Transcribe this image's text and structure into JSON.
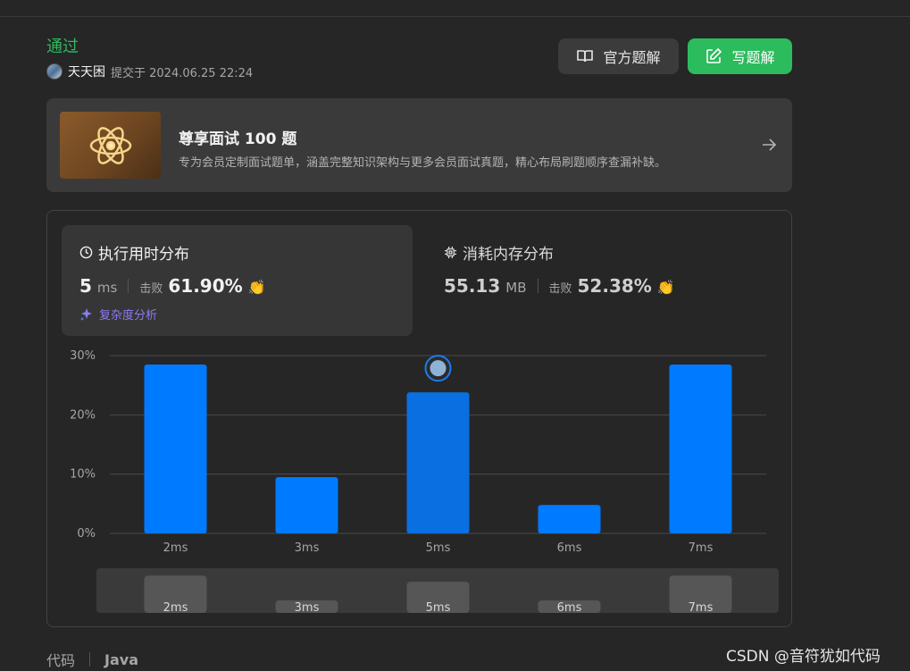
{
  "result": {
    "status": "通过",
    "user": "天天困",
    "submitted_label": "提交于 2024.06.25 22:24"
  },
  "buttons": {
    "official_solution": "官方题解",
    "write_solution": "写题解"
  },
  "promo": {
    "title": "尊享面试 100 题",
    "description": "专为会员定制面试题单，涵盖完整知识架构与更多会员面试真题，精心布局刷题顺序查漏补缺。"
  },
  "runtime": {
    "heading": "执行用时分布",
    "value": "5",
    "unit": "ms",
    "beat_label": "击败",
    "beat_percent": "61.90%",
    "complexity_link": "复杂度分析"
  },
  "memory": {
    "heading": "消耗内存分布",
    "value": "55.13",
    "unit": "MB",
    "beat_label": "击败",
    "beat_percent": "52.38%"
  },
  "chart_data": {
    "type": "bar",
    "categories": [
      "2ms",
      "3ms",
      "5ms",
      "6ms",
      "7ms"
    ],
    "values": [
      28.5,
      9.5,
      23.8,
      4.8,
      28.5
    ],
    "highlight": "5ms",
    "y_ticks": [
      "0%",
      "10%",
      "20%",
      "30%"
    ],
    "ylim": [
      0,
      30
    ],
    "grid": true,
    "colors": {
      "bar": "#007aff",
      "highlight": "#0a6fe0",
      "grid": "#4a4a4a",
      "axis_text": "#a6a6a6"
    }
  },
  "code": {
    "label": "代码",
    "language": "Java"
  },
  "watermark": "CSDN @音符犹如代码",
  "colors": {
    "accent_green": "#2cbb5d",
    "background": "#262626",
    "card": "#363636",
    "link_purple": "#8c7cf0"
  },
  "icons": {
    "official": "book-icon",
    "write": "edit-icon",
    "time": "clock-icon",
    "memory": "chip-icon",
    "clap": "clap-icon",
    "sparkle": "sparkle-icon",
    "arrow": "arrow-right-icon"
  }
}
